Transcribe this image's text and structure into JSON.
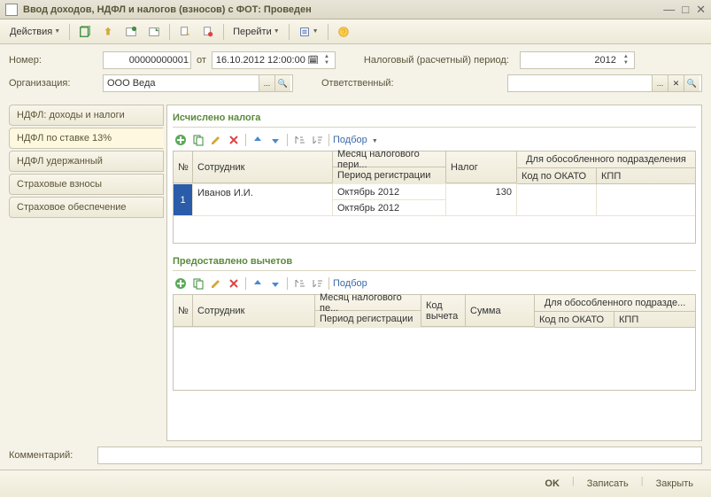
{
  "window": {
    "title": "Ввод доходов, НДФЛ и налогов (взносов) с ФОТ: Проведен"
  },
  "toolbar": {
    "actions_label": "Действия",
    "goto_label": "Перейти"
  },
  "form": {
    "number_label": "Номер:",
    "number_value": "00000000001",
    "from_label": "от",
    "date_value": "16.10.2012 12:00:00",
    "org_label": "Организация:",
    "org_value": "ООО Веда",
    "tax_period_label": "Налоговый (расчетный) период:",
    "tax_period_value": "2012",
    "responsible_label": "Ответственный:",
    "responsible_value": ""
  },
  "tabs": [
    {
      "label": "НДФЛ: доходы и налоги"
    },
    {
      "label": "НДФЛ по ставке 13%"
    },
    {
      "label": "НДФЛ удержанный"
    },
    {
      "label": "Страховые взносы"
    },
    {
      "label": "Страховое обеспечение"
    }
  ],
  "section1": {
    "title": "Исчислено налога",
    "selection_label": "Подбор",
    "columns": {
      "num": "№",
      "employee": "Сотрудник",
      "tax_month": "Месяц налогового пери...",
      "reg_period": "Период регистрации",
      "tax": "Налог",
      "subdivision_group": "Для обособленного подразделения",
      "okato": "Код по ОКАТО",
      "kpp": "КПП"
    },
    "rows": [
      {
        "num": "1",
        "employee": "Иванов И.И.",
        "tax_month": "Октябрь 2012",
        "reg_period": "Октябрь 2012",
        "tax": "130",
        "okato": "",
        "kpp": ""
      }
    ]
  },
  "section2": {
    "title": "Предоставлено вычетов",
    "selection_label": "Подбор",
    "columns": {
      "num": "№",
      "employee": "Сотрудник",
      "tax_month": "Месяц налогового пе...",
      "reg_period": "Период регистрации",
      "deduct_code": "Код вычета",
      "amount": "Сумма",
      "subdivision_group": "Для обособленного подразде...",
      "okato": "Код по ОКАТО",
      "kpp": "КПП"
    }
  },
  "comment_label": "Комментарий:",
  "comment_value": "",
  "buttons": {
    "ok": "OK",
    "save": "Записать",
    "close": "Закрыть"
  }
}
